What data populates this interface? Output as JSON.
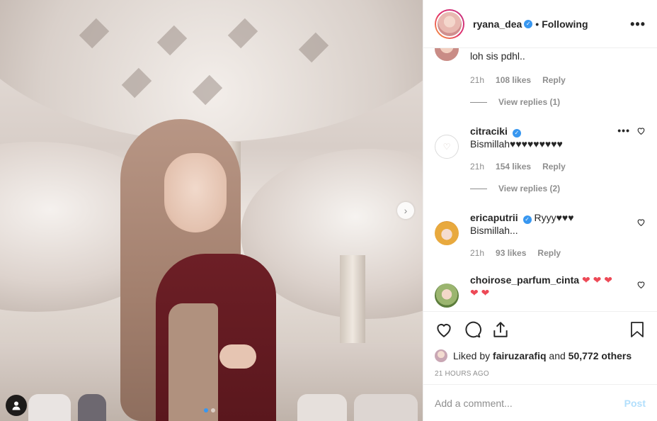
{
  "header": {
    "username": "ryana_dea",
    "separator": "•",
    "follow_status": "Following",
    "more": "•••"
  },
  "comments": [
    {
      "username": "",
      "text": "loh sis pdhl..",
      "time": "21h",
      "likes": "108 likes",
      "reply": "Reply",
      "view_replies": "View replies (1)"
    },
    {
      "username": "citraciki",
      "verified": true,
      "text": "Bismillah♥♥♥♥♥♥♥♥♥",
      "time": "21h",
      "likes": "154 likes",
      "reply": "Reply",
      "more": "•••",
      "view_replies": "View replies (2)"
    },
    {
      "username": "ericaputrii",
      "verified": true,
      "text_inline": "Ryyy♥♥♥",
      "text": "Bismillah...",
      "time": "21h",
      "likes": "93 likes",
      "reply": "Reply"
    },
    {
      "username": "choirose_parfum_cinta",
      "hearts_inline": "❤ ❤ ❤",
      "hearts_next": "❤ ❤"
    }
  ],
  "actions": {
    "liked_by_prefix": "Liked by",
    "liked_by_user": "fairuzarafiq",
    "liked_by_and": "and",
    "liked_by_count": "50,772 others",
    "timestamp": "21 HOURS AGO"
  },
  "comment_box": {
    "placeholder": "Add a comment...",
    "post_label": "Post"
  },
  "carousel": {
    "next_icon": "›",
    "current_slide": 1,
    "total_slides": 2
  },
  "colors": {
    "verified": "#3897f0",
    "heart": "#ed4956",
    "post_disabled": "#b2dffc",
    "active_dot": "#3897f0"
  }
}
